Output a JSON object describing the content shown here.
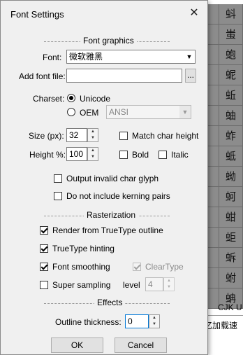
{
  "dialog": {
    "title": "Font Settings",
    "close_glyph": "✕"
  },
  "font_graphics": {
    "heading": "Font graphics",
    "font_label": "Font:",
    "font_value": "微软雅黑",
    "add_font_label": "Add font file:",
    "add_font_value": "",
    "browse_label": "...",
    "charset_label": "Charset:",
    "unicode_label": "Unicode",
    "unicode_selected": true,
    "oem_label": "OEM",
    "oem_selected": false,
    "oem_value": "ANSI",
    "size_label": "Size (px):",
    "size_value": "32",
    "height_label": "Height %:",
    "height_value": "100",
    "match_char_height_label": "Match char height",
    "match_char_height_checked": false,
    "bold_label": "Bold",
    "bold_checked": false,
    "italic_label": "Italic",
    "italic_checked": false,
    "output_invalid_label": "Output invalid char glyph",
    "output_invalid_checked": false,
    "no_kerning_label": "Do not include kerning pairs",
    "no_kerning_checked": false
  },
  "rasterization": {
    "heading": "Rasterization",
    "render_truetype_label": "Render from TrueType outline",
    "render_truetype_checked": true,
    "truetype_hinting_label": "TrueType hinting",
    "truetype_hinting_checked": true,
    "font_smoothing_label": "Font smoothing",
    "font_smoothing_checked": true,
    "cleartype_label": "ClearType",
    "cleartype_checked": true,
    "super_sampling_label": "Super sampling",
    "super_sampling_checked": false,
    "level_label": "level",
    "level_value": "4"
  },
  "effects": {
    "heading": "Effects",
    "outline_label": "Outline thickness:",
    "outline_value": "0"
  },
  "buttons": {
    "ok": "OK",
    "cancel": "Cancel"
  },
  "background": {
    "glyphs": [
      "蚪",
      "蚩",
      "蚫",
      "蚭",
      "蚯",
      "蚰",
      "蚱",
      "蚳",
      "蚴",
      "蚵",
      "蚶",
      "蚷",
      "蚸",
      "蚹",
      "蚺"
    ],
    "left_glyphs": [
      "",
      ",",
      "",
      "",
      "",
      "",
      "",
      "",
      "",
      "",
      ""
    ],
    "cjk_label": "CJK U",
    "status_text": "忆加载速"
  }
}
